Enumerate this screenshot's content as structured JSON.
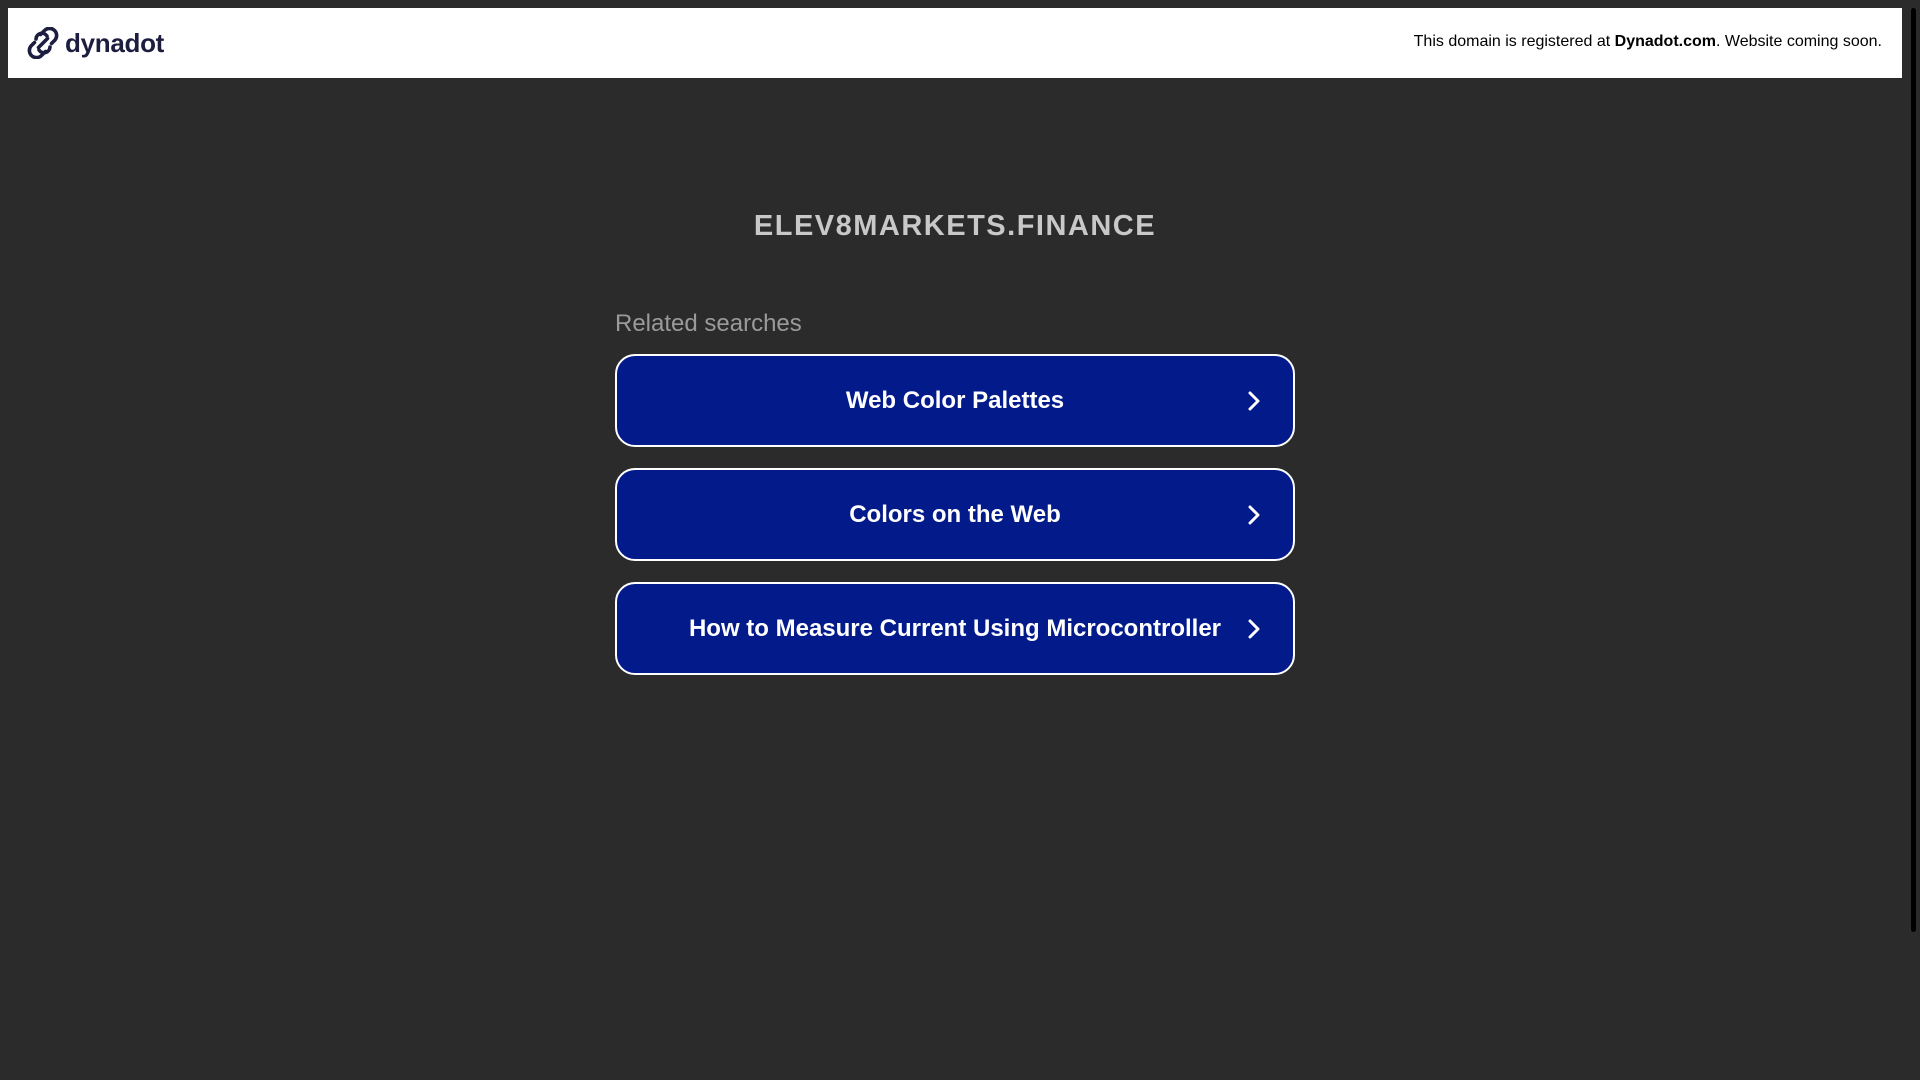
{
  "header": {
    "logo_text": "dynadot",
    "logo_icon": "dynadot-link-icon",
    "notice_prefix": "This domain is registered at ",
    "notice_brand": "Dynadot.com",
    "notice_suffix": ". Website coming soon."
  },
  "main": {
    "domain_name": "ELEV8MARKETS.FINANCE",
    "related_heading": "Related searches",
    "searches": [
      {
        "label": "Web Color Palettes",
        "icon": "chevron-right-icon"
      },
      {
        "label": "Colors on the Web",
        "icon": "chevron-right-icon"
      },
      {
        "label": "How to Measure Current Using Microcontroller",
        "icon": "chevron-right-icon"
      }
    ]
  },
  "colors": {
    "background": "#2b2b2b",
    "header_background": "#ffffff",
    "button_background": "#021a8a",
    "button_border": "#ffffff",
    "domain_title": "#c8c8c8",
    "related_heading": "#9a9a9a"
  }
}
